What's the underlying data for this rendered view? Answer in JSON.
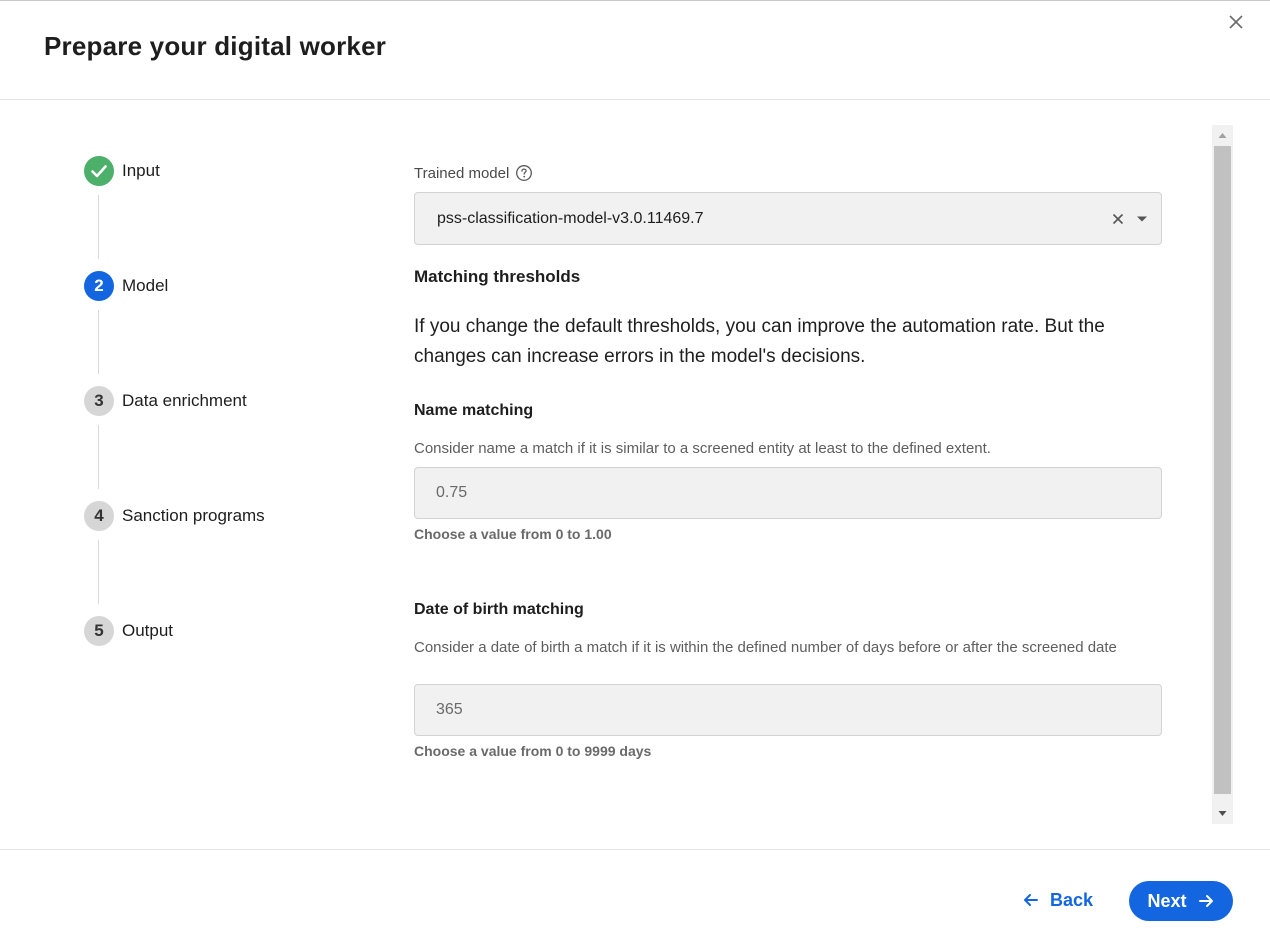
{
  "dialog": {
    "title": "Prepare your digital worker",
    "close_icon": "close-icon"
  },
  "stepper": {
    "steps": [
      {
        "number": "",
        "label": "Input",
        "state": "completed",
        "icon": "check-icon"
      },
      {
        "number": "2",
        "label": "Model",
        "state": "active"
      },
      {
        "number": "3",
        "label": "Data enrichment",
        "state": "pending"
      },
      {
        "number": "4",
        "label": "Sanction programs",
        "state": "pending"
      },
      {
        "number": "5",
        "label": "Output",
        "state": "pending"
      }
    ]
  },
  "model": {
    "label": "Trained model",
    "help_icon": "help-circle-icon",
    "selected_value": "pss-classification-model-v3.0.11469.7"
  },
  "thresholds": {
    "title": "Matching thresholds",
    "intro": "If you change the default thresholds, you can improve the automation rate. But the changes can increase errors in the model's decisions.",
    "name_matching": {
      "title": "Name matching",
      "description": "Consider name a match if it is similar to a screened entity at least to the defined extent.",
      "value": "0.75",
      "hint": "Choose a value from 0 to 1.00"
    },
    "dob_matching": {
      "title": "Date of birth matching",
      "description": "Consider a date of birth a match if it is within the defined number of days before or after the screened date",
      "value": "365",
      "hint": "Choose a value from 0 to 9999 days"
    }
  },
  "footer": {
    "back_label": "Back",
    "next_label": "Next"
  },
  "colors": {
    "accent": "#1366e0",
    "success": "#4caf6a",
    "pending": "#d6d6d6"
  }
}
